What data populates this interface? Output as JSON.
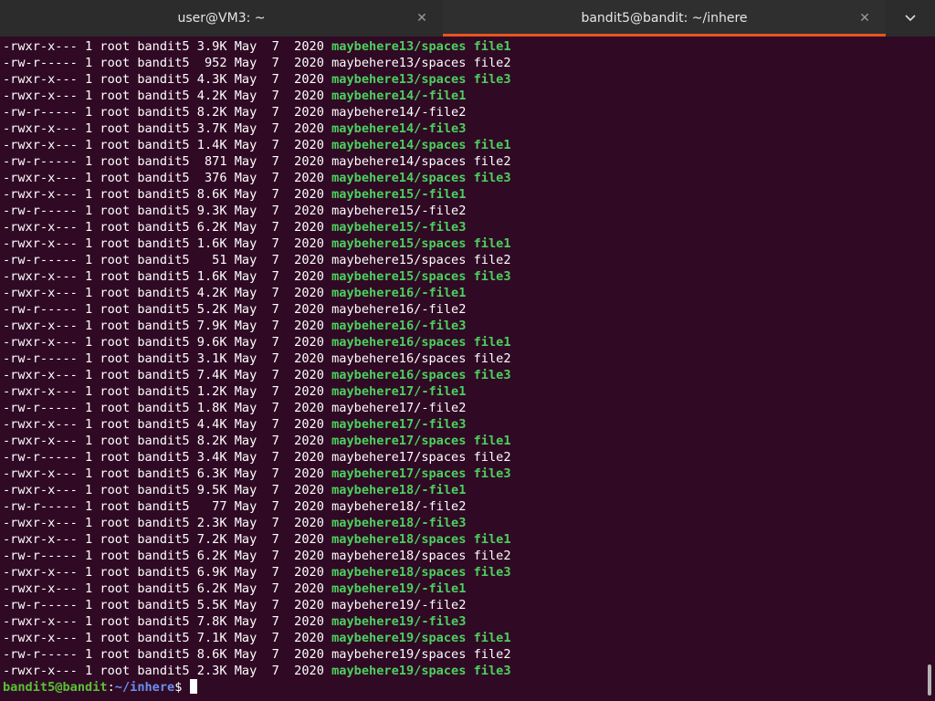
{
  "tabs": [
    {
      "title": "user@VM3: ~",
      "close": "✕",
      "active": false
    },
    {
      "title": "bandit5@bandit: ~/inhere",
      "close": "✕",
      "active": true
    }
  ],
  "tab_menu_icon": "chevron-down-icon",
  "colors": {
    "background": "#300a24",
    "exec_file": "#4cd05f",
    "prompt_user": "#59c134",
    "prompt_path": "#6b8ff0",
    "active_tab_accent": "#e95420"
  },
  "listing": [
    {
      "prefix": "-rwxr-x--- 1 root bandit5 3.9K May  7  2020 ",
      "file": "maybehere13/spaces file1",
      "exec": true
    },
    {
      "prefix": "-rw-r----- 1 root bandit5  952 May  7  2020 ",
      "file": "maybehere13/spaces file2",
      "exec": false
    },
    {
      "prefix": "-rwxr-x--- 1 root bandit5 4.3K May  7  2020 ",
      "file": "maybehere13/spaces file3",
      "exec": true
    },
    {
      "prefix": "-rwxr-x--- 1 root bandit5 4.2K May  7  2020 ",
      "file": "maybehere14/-file1",
      "exec": true
    },
    {
      "prefix": "-rw-r----- 1 root bandit5 8.2K May  7  2020 ",
      "file": "maybehere14/-file2",
      "exec": false
    },
    {
      "prefix": "-rwxr-x--- 1 root bandit5 3.7K May  7  2020 ",
      "file": "maybehere14/-file3",
      "exec": true
    },
    {
      "prefix": "-rwxr-x--- 1 root bandit5 1.4K May  7  2020 ",
      "file": "maybehere14/spaces file1",
      "exec": true
    },
    {
      "prefix": "-rw-r----- 1 root bandit5  871 May  7  2020 ",
      "file": "maybehere14/spaces file2",
      "exec": false
    },
    {
      "prefix": "-rwxr-x--- 1 root bandit5  376 May  7  2020 ",
      "file": "maybehere14/spaces file3",
      "exec": true
    },
    {
      "prefix": "-rwxr-x--- 1 root bandit5 8.6K May  7  2020 ",
      "file": "maybehere15/-file1",
      "exec": true
    },
    {
      "prefix": "-rw-r----- 1 root bandit5 9.3K May  7  2020 ",
      "file": "maybehere15/-file2",
      "exec": false
    },
    {
      "prefix": "-rwxr-x--- 1 root bandit5 6.2K May  7  2020 ",
      "file": "maybehere15/-file3",
      "exec": true
    },
    {
      "prefix": "-rwxr-x--- 1 root bandit5 1.6K May  7  2020 ",
      "file": "maybehere15/spaces file1",
      "exec": true
    },
    {
      "prefix": "-rw-r----- 1 root bandit5   51 May  7  2020 ",
      "file": "maybehere15/spaces file2",
      "exec": false
    },
    {
      "prefix": "-rwxr-x--- 1 root bandit5 1.6K May  7  2020 ",
      "file": "maybehere15/spaces file3",
      "exec": true
    },
    {
      "prefix": "-rwxr-x--- 1 root bandit5 4.2K May  7  2020 ",
      "file": "maybehere16/-file1",
      "exec": true
    },
    {
      "prefix": "-rw-r----- 1 root bandit5 5.2K May  7  2020 ",
      "file": "maybehere16/-file2",
      "exec": false
    },
    {
      "prefix": "-rwxr-x--- 1 root bandit5 7.9K May  7  2020 ",
      "file": "maybehere16/-file3",
      "exec": true
    },
    {
      "prefix": "-rwxr-x--- 1 root bandit5 9.6K May  7  2020 ",
      "file": "maybehere16/spaces file1",
      "exec": true
    },
    {
      "prefix": "-rw-r----- 1 root bandit5 3.1K May  7  2020 ",
      "file": "maybehere16/spaces file2",
      "exec": false
    },
    {
      "prefix": "-rwxr-x--- 1 root bandit5 7.4K May  7  2020 ",
      "file": "maybehere16/spaces file3",
      "exec": true
    },
    {
      "prefix": "-rwxr-x--- 1 root bandit5 1.2K May  7  2020 ",
      "file": "maybehere17/-file1",
      "exec": true
    },
    {
      "prefix": "-rw-r----- 1 root bandit5 1.8K May  7  2020 ",
      "file": "maybehere17/-file2",
      "exec": false
    },
    {
      "prefix": "-rwxr-x--- 1 root bandit5 4.4K May  7  2020 ",
      "file": "maybehere17/-file3",
      "exec": true
    },
    {
      "prefix": "-rwxr-x--- 1 root bandit5 8.2K May  7  2020 ",
      "file": "maybehere17/spaces file1",
      "exec": true
    },
    {
      "prefix": "-rw-r----- 1 root bandit5 3.4K May  7  2020 ",
      "file": "maybehere17/spaces file2",
      "exec": false
    },
    {
      "prefix": "-rwxr-x--- 1 root bandit5 6.3K May  7  2020 ",
      "file": "maybehere17/spaces file3",
      "exec": true
    },
    {
      "prefix": "-rwxr-x--- 1 root bandit5 9.5K May  7  2020 ",
      "file": "maybehere18/-file1",
      "exec": true
    },
    {
      "prefix": "-rw-r----- 1 root bandit5   77 May  7  2020 ",
      "file": "maybehere18/-file2",
      "exec": false
    },
    {
      "prefix": "-rwxr-x--- 1 root bandit5 2.3K May  7  2020 ",
      "file": "maybehere18/-file3",
      "exec": true
    },
    {
      "prefix": "-rwxr-x--- 1 root bandit5 7.2K May  7  2020 ",
      "file": "maybehere18/spaces file1",
      "exec": true
    },
    {
      "prefix": "-rw-r----- 1 root bandit5 6.2K May  7  2020 ",
      "file": "maybehere18/spaces file2",
      "exec": false
    },
    {
      "prefix": "-rwxr-x--- 1 root bandit5 6.9K May  7  2020 ",
      "file": "maybehere18/spaces file3",
      "exec": true
    },
    {
      "prefix": "-rwxr-x--- 1 root bandit5 6.2K May  7  2020 ",
      "file": "maybehere19/-file1",
      "exec": true
    },
    {
      "prefix": "-rw-r----- 1 root bandit5 5.5K May  7  2020 ",
      "file": "maybehere19/-file2",
      "exec": false
    },
    {
      "prefix": "-rwxr-x--- 1 root bandit5 7.8K May  7  2020 ",
      "file": "maybehere19/-file3",
      "exec": true
    },
    {
      "prefix": "-rwxr-x--- 1 root bandit5 7.1K May  7  2020 ",
      "file": "maybehere19/spaces file1",
      "exec": true
    },
    {
      "prefix": "-rw-r----- 1 root bandit5 8.6K May  7  2020 ",
      "file": "maybehere19/spaces file2",
      "exec": false
    },
    {
      "prefix": "-rwxr-x--- 1 root bandit5 2.3K May  7  2020 ",
      "file": "maybehere19/spaces file3",
      "exec": true
    }
  ],
  "prompt": {
    "user_host": "bandit5@bandit",
    "separator": ":",
    "path": "~/inhere",
    "symbol": "$ "
  }
}
